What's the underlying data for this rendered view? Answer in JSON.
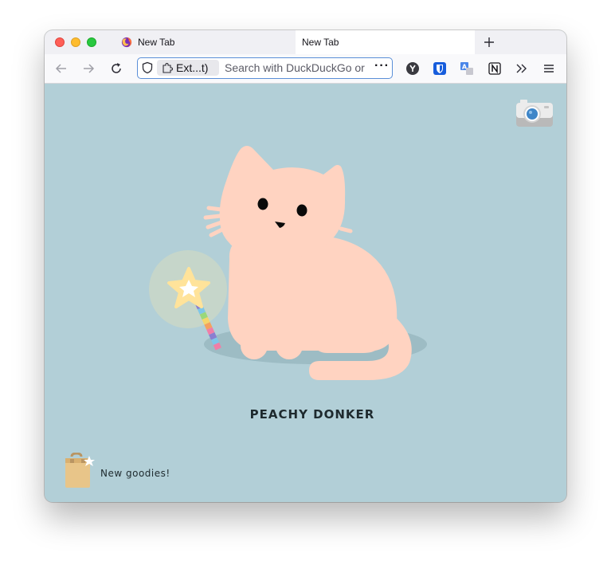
{
  "browser": {
    "tabs": [
      {
        "label": "New Tab",
        "icon": "firefox-icon",
        "active": false
      },
      {
        "label": "New Tab",
        "active": true
      }
    ],
    "new_tab_icon": "plus-icon",
    "nav": {
      "back_icon": "back-arrow-icon",
      "forward_icon": "forward-arrow-icon",
      "reload_icon": "reload-icon"
    },
    "urlbar": {
      "shield_icon": "shield-icon",
      "extension_chip_label": "Ext...t)",
      "placeholder": "Search with DuckDuckGo or",
      "more_icon": "more-dots-icon"
    },
    "toolbar_icons": [
      "ycombinator-icon",
      "bitwarden-icon",
      "translate-icon",
      "notion-icon",
      "overflow-chevron-icon",
      "menu-icon"
    ]
  },
  "page": {
    "background_color": "#b2cfd7",
    "pet_name": "PEACHY DONKER",
    "goodies_label": "New goodies!",
    "camera_icon": "camera-icon",
    "pet_color": "#ffd3c1"
  }
}
